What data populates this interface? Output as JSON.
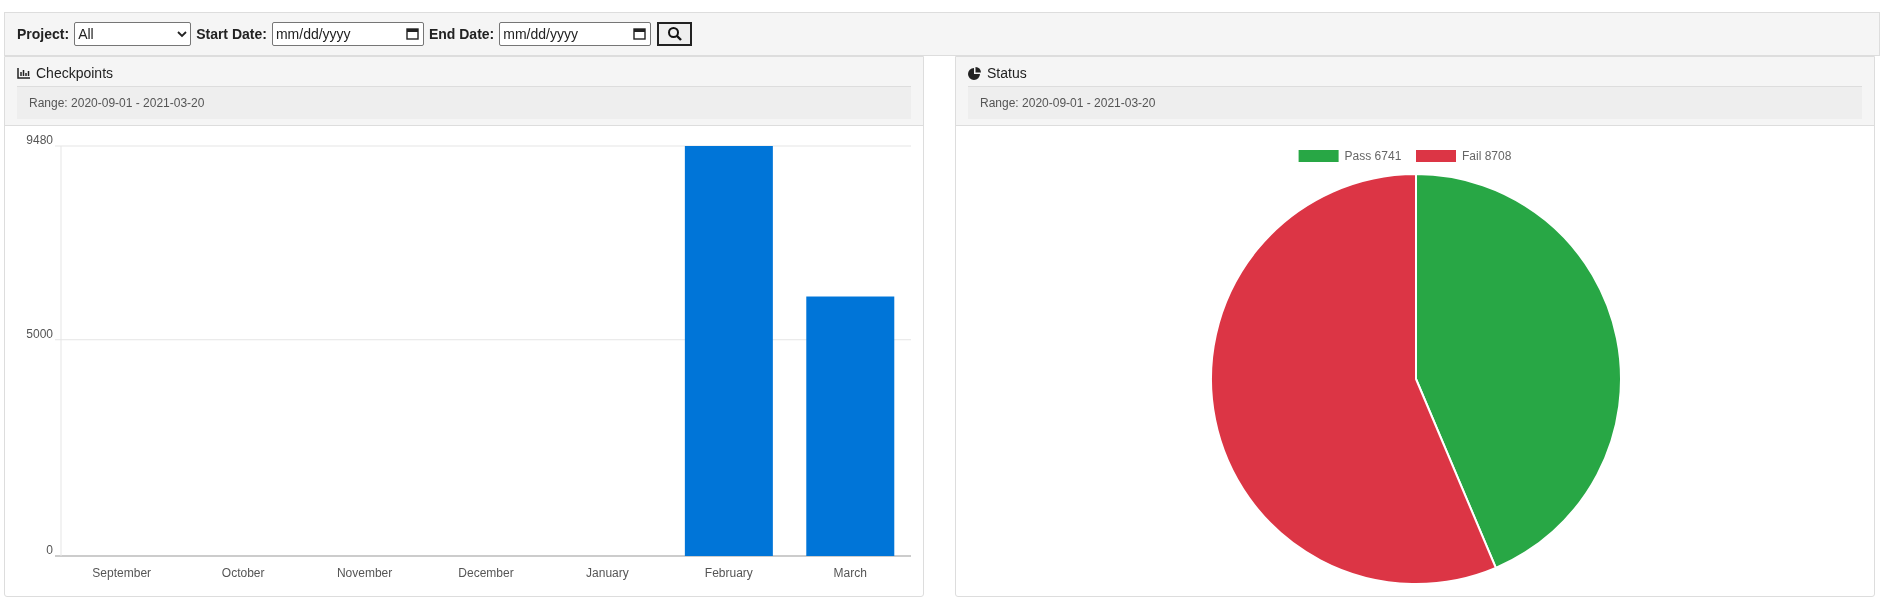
{
  "filters": {
    "project_label": "Project:",
    "project_value": "All",
    "start_label": "Start Date:",
    "start_placeholder": "mm/dd/yyyy",
    "end_label": "End Date:",
    "end_placeholder": "mm/dd/yyyy"
  },
  "panels": [
    {
      "title": "Checkpoints",
      "range": "Range: 2020-09-01 - 2021-03-20",
      "chart_data": {
        "type": "bar",
        "categories": [
          "September",
          "October",
          "November",
          "December",
          "January",
          "February",
          "March"
        ],
        "series": [
          {
            "color": "#0075d8",
            "values": [
              0,
              0,
              0,
              0,
              0,
              9480,
              6000
            ]
          }
        ],
        "ylim": [
          0,
          9480
        ],
        "yticks": [
          0,
          5000,
          9480
        ]
      }
    },
    {
      "title": "Status",
      "range": "Range: 2020-09-01 - 2021-03-20",
      "chart_data": {
        "type": "pie",
        "categories": [
          "Pass 6741",
          "Fail 8708"
        ],
        "values": [
          6741,
          8708
        ],
        "colors": [
          "#28a745",
          "#dc3545"
        ],
        "legend": "top"
      }
    }
  ]
}
